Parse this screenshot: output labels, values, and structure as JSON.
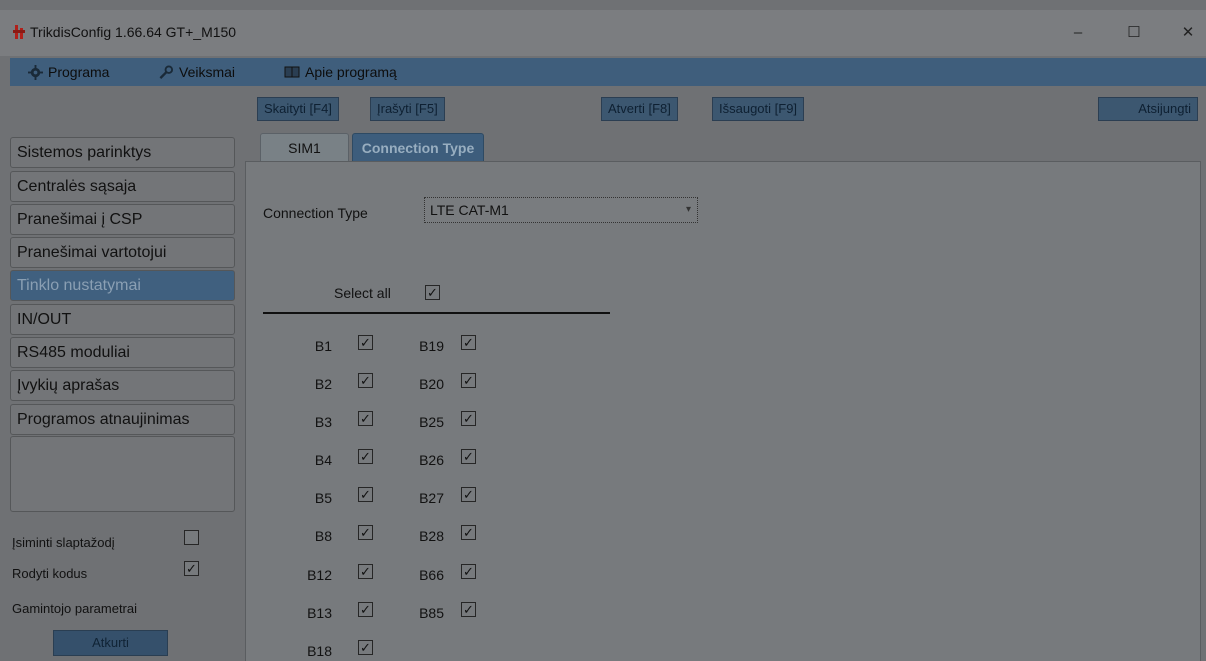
{
  "window": {
    "title": "TrikdisConfig 1.66.64  GT+_M150",
    "minimize": "–",
    "maximize": "☐",
    "close": "✕"
  },
  "menu": {
    "programa": "Programa",
    "veiksmai": "Veiksmai",
    "apie": "Apie programą"
  },
  "toolbar": {
    "read": "Skaityti [F4]",
    "write": "Įrašyti [F5]",
    "open": "Atverti [F8]",
    "save": "Išsaugoti [F9]",
    "disconnect": "Atsijungti"
  },
  "sidebar": {
    "items": [
      {
        "label": "Sistemos parinktys"
      },
      {
        "label": "Centralės sąsaja"
      },
      {
        "label": "Pranešimai į CSP"
      },
      {
        "label": "Pranešimai vartotojui"
      },
      {
        "label": "Tinklo nustatymai",
        "active": true
      },
      {
        "label": "IN/OUT"
      },
      {
        "label": "RS485 moduliai"
      },
      {
        "label": "Įvykių aprašas"
      },
      {
        "label": "Programos atnaujinimas"
      }
    ],
    "remember_password": "Įsiminti slaptažodį",
    "remember_password_checked": false,
    "show_codes": "Rodyti kodus",
    "show_codes_checked": true,
    "factory_params": "Gamintojo parametrai",
    "restore": "Atkurti"
  },
  "tabs": {
    "sim1": "SIM1",
    "connection_type": "Connection Type"
  },
  "connection": {
    "label": "Connection Type",
    "value": "LTE CAT-M1",
    "select_all": "Select all",
    "select_all_checked": true
  },
  "bands": {
    "left": [
      {
        "name": "B1",
        "checked": true
      },
      {
        "name": "B2",
        "checked": true
      },
      {
        "name": "B3",
        "checked": true
      },
      {
        "name": "B4",
        "checked": true
      },
      {
        "name": "B5",
        "checked": true
      },
      {
        "name": "B8",
        "checked": true
      },
      {
        "name": "B12",
        "checked": true
      },
      {
        "name": "B13",
        "checked": true
      },
      {
        "name": "B18",
        "checked": true
      }
    ],
    "right": [
      {
        "name": "B19",
        "checked": true
      },
      {
        "name": "B20",
        "checked": true
      },
      {
        "name": "B25",
        "checked": true
      },
      {
        "name": "B26",
        "checked": true
      },
      {
        "name": "B27",
        "checked": true
      },
      {
        "name": "B28",
        "checked": true
      },
      {
        "name": "B66",
        "checked": true
      },
      {
        "name": "B85",
        "checked": true
      }
    ]
  }
}
